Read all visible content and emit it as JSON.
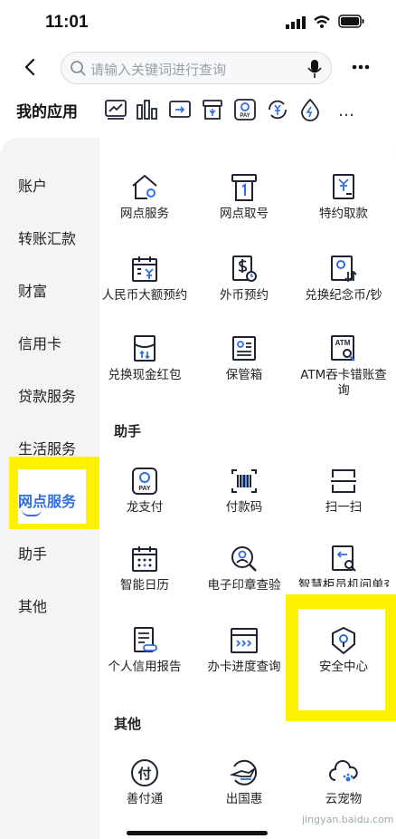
{
  "status_bar": {
    "time": "11:01"
  },
  "search": {
    "placeholder": "请输入关键词进行查询"
  },
  "my_apps": {
    "title": "我的应用",
    "more": "…"
  },
  "sidebar": {
    "items": [
      {
        "label": "账户"
      },
      {
        "label": "转账汇款"
      },
      {
        "label": "财富"
      },
      {
        "label": "信用卡"
      },
      {
        "label": "贷款服务"
      },
      {
        "label": "生活服务"
      },
      {
        "label": "网点服务",
        "active": true
      },
      {
        "label": "助手"
      },
      {
        "label": "其他"
      }
    ]
  },
  "grid": {
    "row1": [
      "网点服务",
      "网点取号",
      "特约取款"
    ],
    "row2": [
      "人民币大额预约",
      "外币预约",
      "兑换纪念币/钞"
    ],
    "row3": [
      "兑换现金红包",
      "保管箱",
      "ATM吞卡错账查询"
    ],
    "section_helper": "助手",
    "row4": [
      "龙支付",
      "付款码",
      "扫一扫"
    ],
    "row5": [
      "智能日历",
      "电子印章查验",
      "智慧柜员机间单查询"
    ],
    "row6": [
      "个人信用报告",
      "办卡进度查询",
      "安全中心"
    ],
    "section_other": "其他",
    "row7": [
      "善付通",
      "出国惠",
      "云宠物"
    ]
  },
  "icon_text": {
    "pay": "PAY",
    "atm": "ATM",
    "shan": "付"
  },
  "watermark": "jingyan.baidu.com",
  "colors": {
    "accent": "#2f6fe4",
    "icon_stroke": "#1d2333",
    "highlight": "#fff200"
  }
}
